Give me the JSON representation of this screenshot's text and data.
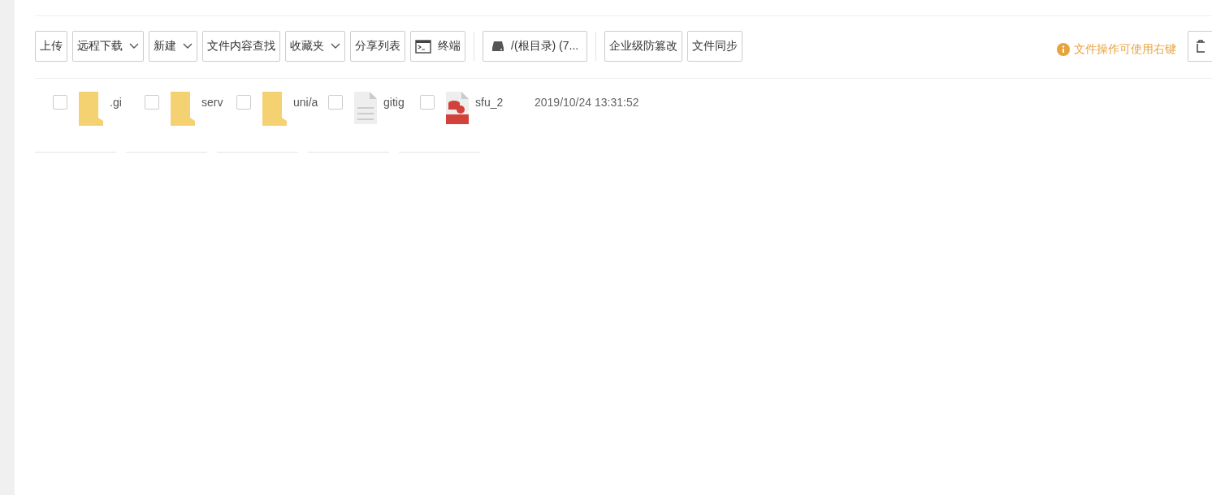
{
  "toolbar": {
    "buttons": [
      {
        "label": "上传",
        "kind": "plain"
      },
      {
        "label": "远程下载",
        "kind": "dropdown"
      },
      {
        "label": "新建",
        "kind": "dropdown"
      },
      {
        "label": "文件内容查找",
        "kind": "plain"
      },
      {
        "label": "收藏夹",
        "kind": "dropdown"
      },
      {
        "label": "分享列表",
        "kind": "plain"
      },
      {
        "label": "终端",
        "kind": "terminal"
      },
      {
        "label": "/(根目录) (7...",
        "kind": "disk"
      },
      {
        "label": "企业级防篡改",
        "kind": "plain"
      },
      {
        "label": "文件同步",
        "kind": "plain"
      }
    ],
    "hint": "文件操作可使用右键"
  },
  "files": [
    {
      "name": ".gi",
      "kind": "folder",
      "checked": false
    },
    {
      "name": "serv",
      "kind": "folder",
      "checked": false
    },
    {
      "name": "uni/a",
      "kind": "folder",
      "checked": false
    },
    {
      "name": "gitig",
      "kind": "file",
      "checked": false
    },
    {
      "name": "sfu_2",
      "kind": "sql",
      "checked": false
    }
  ],
  "last_modified": "2019/10/24 13:31:52"
}
